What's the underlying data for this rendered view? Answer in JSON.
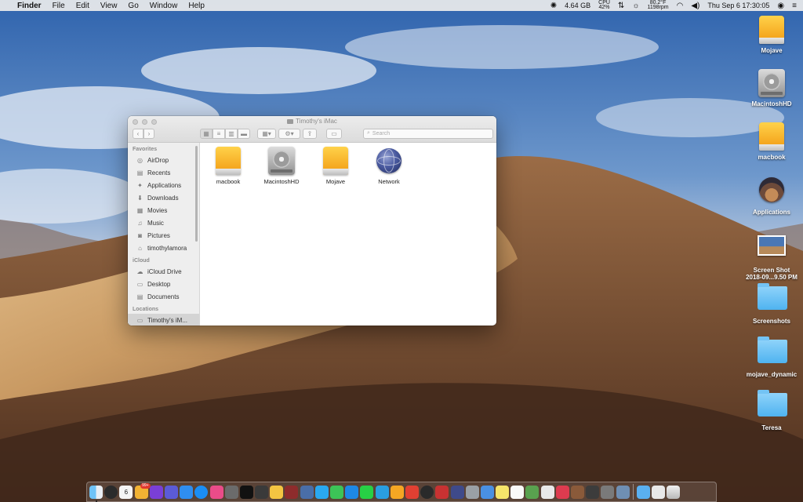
{
  "menubar": {
    "apple_icon": "apple-logo",
    "app_name": "Finder",
    "menus": [
      "File",
      "Edit",
      "View",
      "Go",
      "Window",
      "Help"
    ],
    "status": {
      "memory": "4.64 GB",
      "cpu_top": "CPU",
      "cpu_bottom": "42%",
      "temp_top": "80.2°F",
      "temp_bottom": "1198rpm",
      "datetime": "Thu Sep 6  17:30:05"
    }
  },
  "desktop": {
    "items": [
      {
        "label": "Mojave",
        "kind": "orange-drive"
      },
      {
        "label": "MacintoshHD",
        "kind": "gray-drive"
      },
      {
        "label": "macbook",
        "kind": "orange-drive"
      },
      {
        "label": "Applications",
        "kind": "app"
      },
      {
        "label": "Screen Shot",
        "label2": "2018-09...9.50 PM",
        "kind": "screenshot"
      },
      {
        "label": "Screenshots",
        "kind": "folder"
      },
      {
        "label": "mojave_dynamic",
        "kind": "folder"
      },
      {
        "label": "Teresa",
        "kind": "folder"
      }
    ]
  },
  "finder": {
    "title": "Timothy's iMac",
    "search_placeholder": "Search",
    "sidebar": {
      "favorites_header": "Favorites",
      "favorites": [
        {
          "label": "AirDrop",
          "icon": "airdrop-icon",
          "glyph": "◎"
        },
        {
          "label": "Recents",
          "icon": "recents-icon",
          "glyph": "▤"
        },
        {
          "label": "Applications",
          "icon": "applications-icon",
          "glyph": "✦"
        },
        {
          "label": "Downloads",
          "icon": "downloads-icon",
          "glyph": "⬇"
        },
        {
          "label": "Movies",
          "icon": "movies-icon",
          "glyph": "▦"
        },
        {
          "label": "Music",
          "icon": "music-icon",
          "glyph": "♫"
        },
        {
          "label": "Pictures",
          "icon": "pictures-icon",
          "glyph": "◙"
        },
        {
          "label": "timothylamora",
          "icon": "home-icon",
          "glyph": "⌂"
        }
      ],
      "icloud_header": "iCloud",
      "icloud": [
        {
          "label": "iCloud Drive",
          "icon": "icloud-drive-icon",
          "glyph": "☁"
        },
        {
          "label": "Desktop",
          "icon": "desktop-icon",
          "glyph": "▭"
        },
        {
          "label": "Documents",
          "icon": "documents-icon",
          "glyph": "▤"
        }
      ],
      "locations_header": "Locations",
      "locations": [
        {
          "label": "Timothy's iM...",
          "icon": "imac-icon",
          "glyph": "▭"
        }
      ]
    },
    "items": [
      {
        "label": "macbook",
        "kind": "orange-drive"
      },
      {
        "label": "MacintoshHD",
        "kind": "gray-drive"
      },
      {
        "label": "Mojave",
        "kind": "orange-drive"
      },
      {
        "label": "Network",
        "kind": "network"
      }
    ]
  },
  "dock": {
    "calendar_day": "6",
    "badge": "99+",
    "colors": [
      "#3a8ee6",
      "#2b2b2b",
      "#f5f5f5",
      "#f2b233",
      "#7a3fd6",
      "#5b5bd6",
      "#2f8ef0",
      "#1a8ef5",
      "#ea4c89",
      "#6b6b6b",
      "#111111",
      "#3a3a3a",
      "#f4c542",
      "#8e2c2c",
      "#4a6ea8",
      "#2aa8f0",
      "#3cc457",
      "#1e88e5",
      "#27d045",
      "#2a9ee0",
      "#f5a623",
      "#e14032",
      "#2a2a2a",
      "#c83232",
      "#3f4a8a",
      "#9aa0a6",
      "#4a90e2",
      "#f5e46a",
      "#f9f9f9",
      "#59a14f",
      "#e9e9e9",
      "#dd3b4f",
      "#8a5a3a",
      "#3c3c3c",
      "#7a7a7a",
      "#6f8fb3",
      "#5ab0f0",
      "#e8e8e8",
      "#bdbdbd"
    ]
  }
}
